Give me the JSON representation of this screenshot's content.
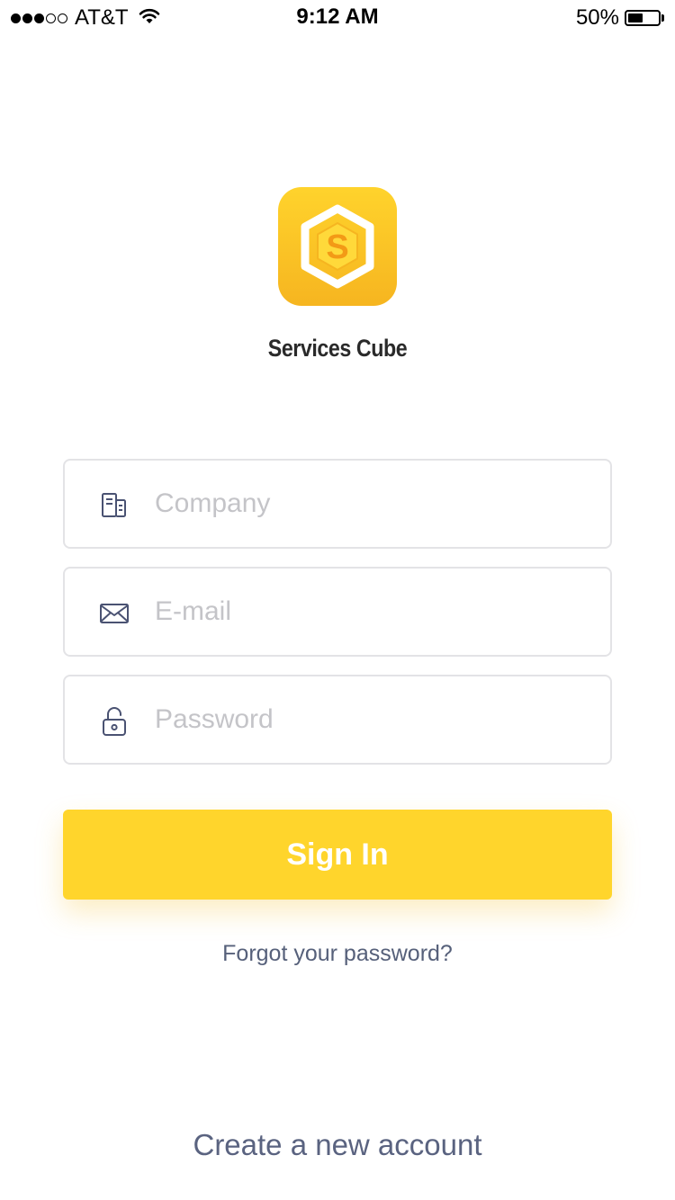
{
  "status_bar": {
    "carrier": "AT&T",
    "time": "9:12 AM",
    "battery": "50%",
    "battery_level": 0.5,
    "signal_bars": 3,
    "signal_max": 5
  },
  "app": {
    "name": "Services Cube",
    "logo_letter": "S",
    "logo_colors": [
      "#ffd32c",
      "#f6b520"
    ]
  },
  "form": {
    "company_placeholder": "Company",
    "company_icon": "building-icon",
    "email_placeholder": "E-mail",
    "email_icon": "envelope-icon",
    "password_placeholder": "Password",
    "password_icon": "unlock-icon"
  },
  "actions": {
    "sign_in_label": "Sign In",
    "forgot_password_label": "Forgot your password?",
    "create_account_label": "Create a new account"
  },
  "colors": {
    "accent": "#ffd52c",
    "link": "#56607a",
    "icon": "#4a5272",
    "placeholder": "#c4c4c8"
  }
}
